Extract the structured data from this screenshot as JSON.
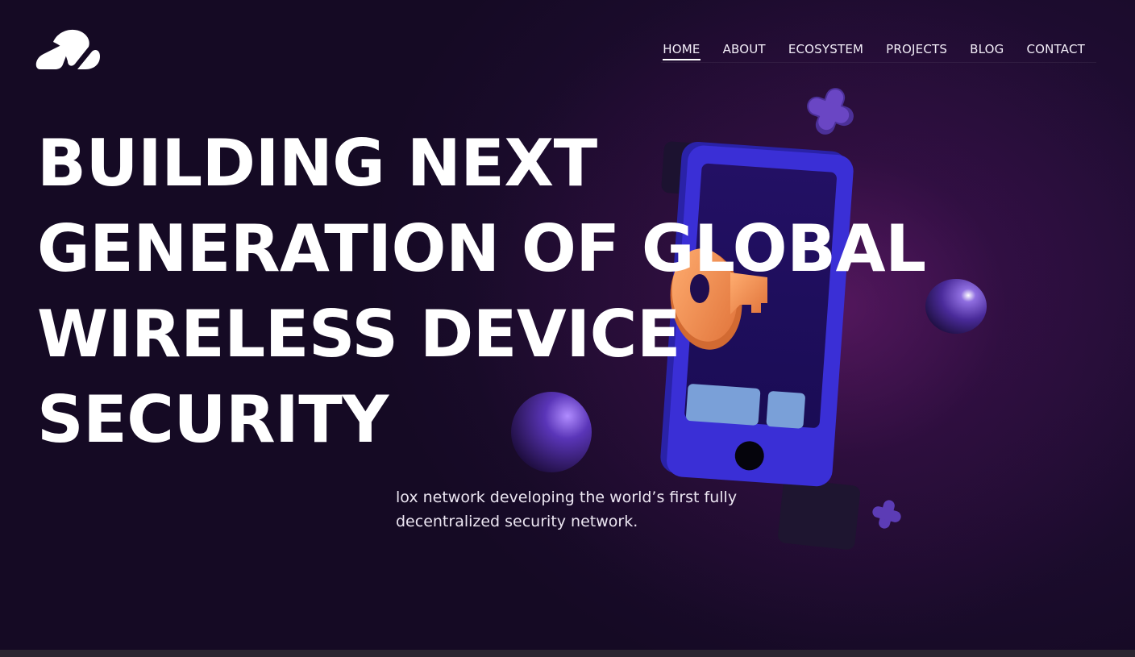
{
  "brand": {
    "logo_icon": "checkmark-cloud-logo"
  },
  "nav": {
    "items": [
      {
        "label": "HOME",
        "active": true
      },
      {
        "label": "ABOUT",
        "active": false
      },
      {
        "label": "ECOSYSTEM",
        "active": false
      },
      {
        "label": "PROJECTS",
        "active": false
      },
      {
        "label": "BLOG",
        "active": false
      },
      {
        "label": "CONTACT",
        "active": false
      }
    ]
  },
  "hero": {
    "headline_lines": [
      "BUILDING NEXT",
      "GENERATION OF GLOBAL",
      "WIRELESS DEVICE",
      "SECURITY"
    ],
    "subtext": "lox network developing the world’s first fully decentralized security network."
  },
  "colors": {
    "background": "#150a24",
    "phone": "#3a2fd6",
    "key": "#f08a4b",
    "sphere": "#5a35b8",
    "accent_glow": "#7a1e7a"
  }
}
